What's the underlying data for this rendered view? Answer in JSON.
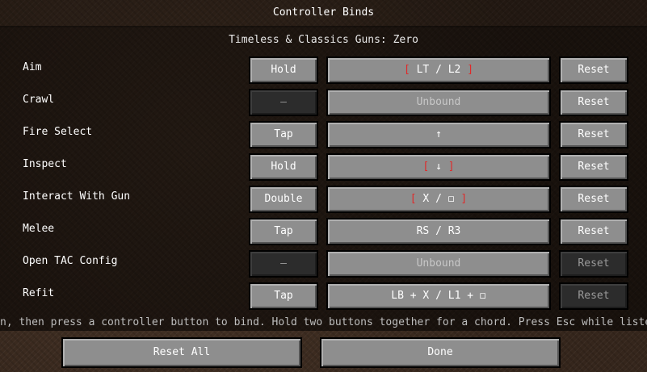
{
  "header": {
    "title": "Controller Binds"
  },
  "subtitle": "Timeless & Classics Guns: Zero",
  "binds": [
    {
      "label": "Aim",
      "mode": "Hold",
      "mode_disabled": false,
      "key": "LT / L2",
      "key_bracketed": true,
      "unbound": false,
      "reset": "Reset",
      "reset_disabled": false
    },
    {
      "label": "Crawl",
      "mode": "—",
      "mode_disabled": true,
      "key": "Unbound",
      "key_bracketed": false,
      "unbound": true,
      "reset": "Reset",
      "reset_disabled": false
    },
    {
      "label": "Fire Select",
      "mode": "Tap",
      "mode_disabled": false,
      "key": "↑",
      "key_bracketed": false,
      "unbound": false,
      "reset": "Reset",
      "reset_disabled": false
    },
    {
      "label": "Inspect",
      "mode": "Hold",
      "mode_disabled": false,
      "key": "↓",
      "key_bracketed": true,
      "unbound": false,
      "reset": "Reset",
      "reset_disabled": false
    },
    {
      "label": "Interact With Gun",
      "mode": "Double",
      "mode_disabled": false,
      "key": "X / ◻",
      "key_bracketed": true,
      "unbound": false,
      "reset": "Reset",
      "reset_disabled": false
    },
    {
      "label": "Melee",
      "mode": "Tap",
      "mode_disabled": false,
      "key": "RS / R3",
      "key_bracketed": false,
      "unbound": false,
      "reset": "Reset",
      "reset_disabled": false
    },
    {
      "label": "Open TAC Config",
      "mode": "—",
      "mode_disabled": true,
      "key": "Unbound",
      "key_bracketed": false,
      "unbound": true,
      "reset": "Reset",
      "reset_disabled": true
    },
    {
      "label": "Refit",
      "mode": "Tap",
      "mode_disabled": false,
      "key": "LB + X / L1 + ◻",
      "key_bracketed": false,
      "unbound": false,
      "reset": "Reset",
      "reset_disabled": true
    }
  ],
  "hint": "n, then press a controller button to bind. Hold two buttons together for a chord. Press Esc while listening",
  "footer": {
    "reset_all": "Reset All",
    "done": "Done"
  },
  "colors": {
    "bracket": "#e02a2a",
    "button_bg": "#8e8e8e",
    "button_disabled_bg": "#2c2c2c"
  }
}
